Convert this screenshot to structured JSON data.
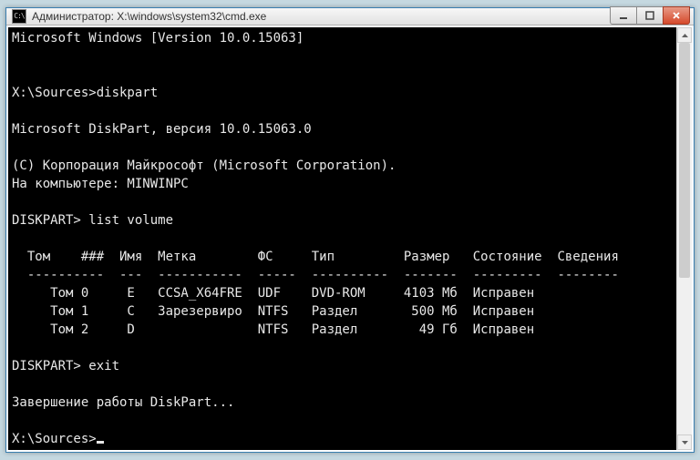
{
  "title": "Администратор: X:\\windows\\system32\\cmd.exe",
  "sysicon_text": "C:\\",
  "lines": {
    "l0": "Microsoft Windows [Version 10.0.15063]",
    "l1": "",
    "l2": "",
    "l3": "X:\\Sources>diskpart",
    "l4": "",
    "l5": "Microsoft DiskPart, версия 10.0.15063.0",
    "l6": "",
    "l7": "(C) Корпорация Майкрософт (Microsoft Corporation).",
    "l8": "На компьютере: MINWINPC",
    "l9": "",
    "l10": "DISKPART> list volume",
    "l11": "",
    "l12": "  Том    ###  Имя  Метка        ФС     Тип         Размер   Состояние  Сведения",
    "l13": "  ----------  ---  -----------  -----  ----------  -------  ---------  --------",
    "l14": "     Том 0     E   CCSA_X64FRE  UDF    DVD-ROM     4103 Мб  Исправен",
    "l15": "     Том 1     C   Зарезервиро  NTFS   Раздел       500 Мб  Исправен",
    "l16": "     Том 2     D                NTFS   Раздел        49 Гб  Исправен",
    "l17": "",
    "l18": "DISKPART> exit",
    "l19": "",
    "l20": "Завершение работы DiskPart...",
    "l21": "",
    "l22": "X:\\Sources>"
  },
  "chart_data": {
    "type": "table",
    "title": "list volume",
    "columns": [
      "Том ###",
      "Имя",
      "Метка",
      "ФС",
      "Тип",
      "Размер",
      "Состояние",
      "Сведения"
    ],
    "rows": [
      {
        "volume": "Том 0",
        "letter": "E",
        "label": "CCSA_X64FRE",
        "fs": "UDF",
        "type": "DVD-ROM",
        "size": "4103 Мб",
        "status": "Исправен",
        "info": ""
      },
      {
        "volume": "Том 1",
        "letter": "C",
        "label": "Зарезервиро",
        "fs": "NTFS",
        "type": "Раздел",
        "size": "500 Мб",
        "status": "Исправен",
        "info": ""
      },
      {
        "volume": "Том 2",
        "letter": "D",
        "label": "",
        "fs": "NTFS",
        "type": "Раздел",
        "size": "49 Гб",
        "status": "Исправен",
        "info": ""
      }
    ]
  }
}
